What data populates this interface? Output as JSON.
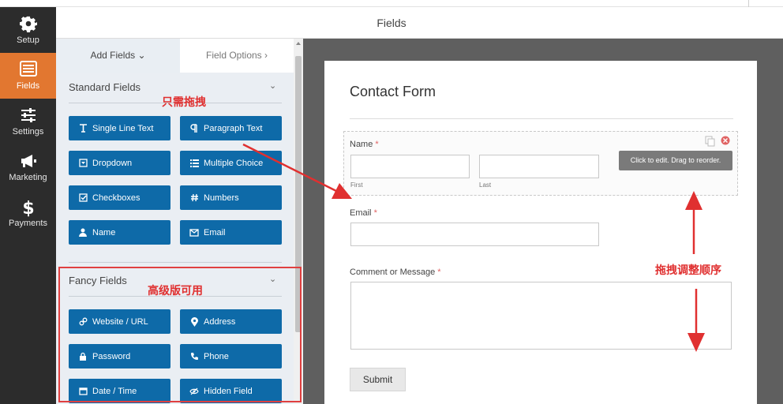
{
  "header": {
    "title": "Fields"
  },
  "nav": {
    "items": [
      {
        "label": "Setup",
        "icon": "gear-icon"
      },
      {
        "label": "Fields",
        "icon": "list-icon",
        "active": true
      },
      {
        "label": "Settings",
        "icon": "sliders-icon"
      },
      {
        "label": "Marketing",
        "icon": "megaphone-icon"
      },
      {
        "label": "Payments",
        "icon": "dollar-icon"
      }
    ]
  },
  "tabs": {
    "add": "Add Fields ⌄",
    "options": "Field Options ›"
  },
  "standard": {
    "title": "Standard Fields",
    "buttons": [
      {
        "label": "Single Line Text",
        "icon": "text-cursor-icon"
      },
      {
        "label": "Paragraph Text",
        "icon": "pilcrow-icon"
      },
      {
        "label": "Dropdown",
        "icon": "dropdown-icon"
      },
      {
        "label": "Multiple Choice",
        "icon": "list-bullet-icon"
      },
      {
        "label": "Checkboxes",
        "icon": "checkbox-icon"
      },
      {
        "label": "Numbers",
        "icon": "hash-icon"
      },
      {
        "label": "Name",
        "icon": "user-icon"
      },
      {
        "label": "Email",
        "icon": "envelope-icon"
      }
    ]
  },
  "fancy": {
    "title": "Fancy Fields",
    "buttons": [
      {
        "label": "Website / URL",
        "icon": "link-icon"
      },
      {
        "label": "Address",
        "icon": "map-pin-icon"
      },
      {
        "label": "Password",
        "icon": "lock-icon"
      },
      {
        "label": "Phone",
        "icon": "phone-icon"
      },
      {
        "label": "Date / Time",
        "icon": "calendar-icon"
      },
      {
        "label": "Hidden Field",
        "icon": "eye-slash-icon"
      }
    ]
  },
  "form": {
    "title": "Contact Form",
    "name_label": "Name",
    "first": "First",
    "last": "Last",
    "email_label": "Email",
    "message_label": "Comment or Message",
    "required_mark": "*",
    "tooltip": "Click to edit. Drag to reorder.",
    "submit": "Submit"
  },
  "annotations": {
    "drag_only": "只需拖拽",
    "premium": "高级版可用",
    "reorder": "拖拽调整顺序"
  },
  "colors": {
    "accent": "#e27730",
    "button": "#0e6aa8",
    "annotation": "#e03030"
  }
}
